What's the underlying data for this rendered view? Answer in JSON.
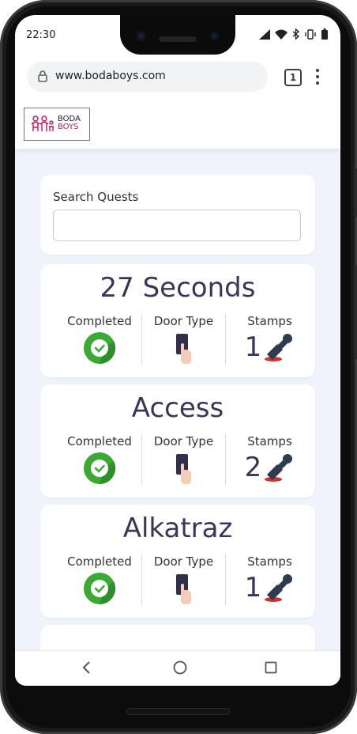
{
  "status_bar": {
    "time": "22:30"
  },
  "browser": {
    "url": "www.bodaboys.com",
    "tab_count": "1"
  },
  "site": {
    "logo_line1": "BODA",
    "logo_line2": "BOYS",
    "search": {
      "label": "Search Quests",
      "value": "",
      "placeholder": ""
    },
    "quests": [
      {
        "title": "27 Seconds",
        "completed_label": "Completed",
        "door_label": "Door Type",
        "stamps_label": "Stamps",
        "stamps": "1"
      },
      {
        "title": "Access",
        "completed_label": "Completed",
        "door_label": "Door Type",
        "stamps_label": "Stamps",
        "stamps": "2"
      },
      {
        "title": "Alkatraz",
        "completed_label": "Completed",
        "door_label": "Door Type",
        "stamps_label": "Stamps",
        "stamps": "1"
      }
    ]
  },
  "colors": {
    "brand": "#c2185b",
    "title": "#3b3557",
    "check": "#3aaa35",
    "background": "#eff3fb"
  }
}
